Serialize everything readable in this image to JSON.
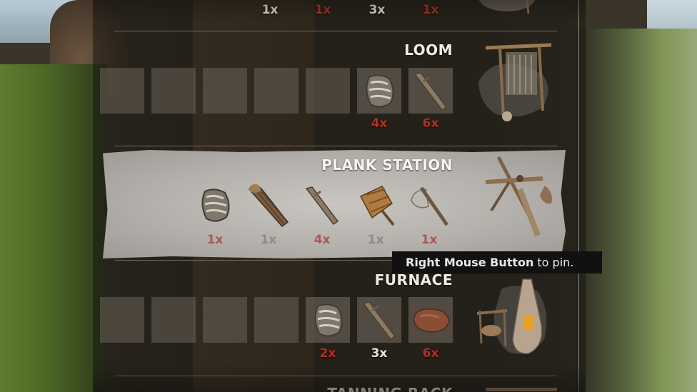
{
  "top_row": {
    "quantities": [
      {
        "text": "1x",
        "met": true
      },
      {
        "text": "1x",
        "met": false
      },
      {
        "text": "3x",
        "met": true
      },
      {
        "text": "1x",
        "met": false
      }
    ]
  },
  "loom": {
    "title": "LOOM",
    "items": [
      {
        "icon": "fiber-bundle-icon",
        "qty": "4x",
        "met": false
      },
      {
        "icon": "branch-stick-icon",
        "qty": "6x",
        "met": false
      }
    ],
    "station_icon": "loom-icon"
  },
  "plank_station": {
    "title": "PLANK STATION",
    "items": [
      {
        "icon": "fiber-bundle-icon",
        "qty": "1x",
        "met": false
      },
      {
        "icon": "log-icon",
        "qty": "1x",
        "met": true
      },
      {
        "icon": "branch-stick-icon",
        "qty": "4x",
        "met": false
      },
      {
        "icon": "wooden-plank-bundle-icon",
        "qty": "1x",
        "met": true
      },
      {
        "icon": "stone-axe-icon",
        "qty": "1x",
        "met": false
      }
    ],
    "station_icon": "plank-station-icon"
  },
  "tooltip": {
    "bold": "Right Mouse Button",
    "rest": "to pin."
  },
  "furnace": {
    "title": "FURNACE",
    "items": [
      {
        "icon": "fiber-bundle-icon",
        "qty": "2x",
        "met": false
      },
      {
        "icon": "branch-stick-icon",
        "qty": "3x",
        "met": true
      },
      {
        "icon": "clay-lump-icon",
        "qty": "6x",
        "met": false
      }
    ],
    "station_icon": "furnace-icon"
  },
  "tanning_rack": {
    "title": "TANNING RACK"
  },
  "colors": {
    "met": "#e6e2d9",
    "unmet": "#b0301f"
  }
}
